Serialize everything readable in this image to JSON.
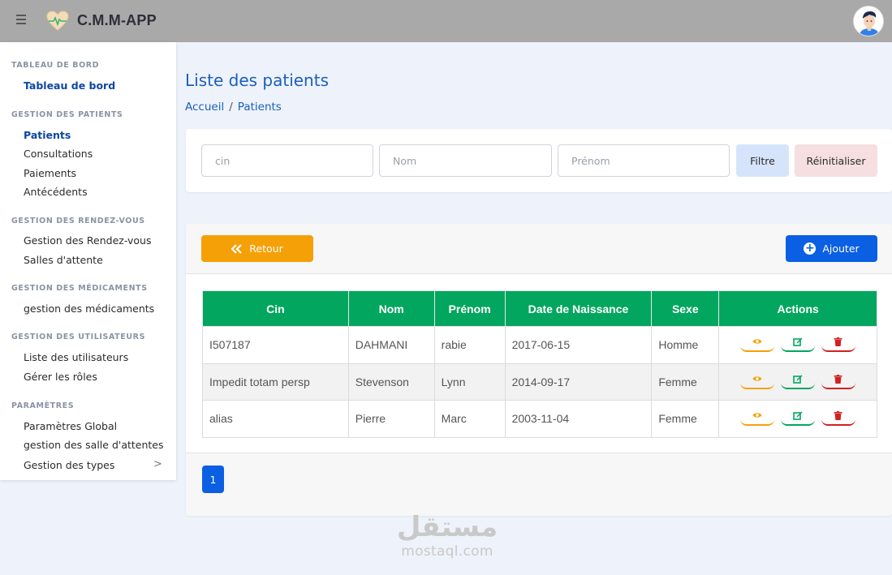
{
  "header": {
    "app_title": "C.M.M-APP",
    "menu_icon": "hamburger-icon",
    "logo_icon": "heart-pulse-icon",
    "avatar_icon": "user-avatar-icon"
  },
  "sidebar": {
    "sections": [
      {
        "heading": "TABLEAU DE BORD",
        "items": [
          "Tableau de bord"
        ]
      },
      {
        "heading": "GESTION DES PATIENTS",
        "items": [
          "Patients",
          "Consultations",
          "Paiements",
          "Antécédents"
        ]
      },
      {
        "heading": "GESTION DES RENDEZ-VOUS",
        "items": [
          "Gestion des Rendez-vous",
          "Salles d'attente"
        ]
      },
      {
        "heading": "GESTION DES MÉDICAMENTS",
        "items": [
          "gestion des médicaments"
        ]
      },
      {
        "heading": "GESTION DES UTILISATEURS",
        "items": [
          "Liste des utilisateurs",
          "Gérer les rôles"
        ]
      },
      {
        "heading": "PARAMÈTRES",
        "items": [
          "Paramètres Global",
          "gestion des salle d'attentes",
          "Gestion des types"
        ]
      }
    ],
    "chevron": ">"
  },
  "main": {
    "title": "Liste des patients",
    "breadcrumb": {
      "home": "Accueil",
      "separator": "/",
      "current": "Patients"
    }
  },
  "filters": {
    "cin_placeholder": "cin",
    "nom_placeholder": "Nom",
    "prenom_placeholder": "Prénom",
    "filter_label": "Filtre",
    "reset_label": "Réinitialiser"
  },
  "toolbar": {
    "back_label": "Retour",
    "back_icon": "double-chevron-left-icon",
    "add_label": "Ajouter",
    "add_icon": "plus-circle-icon"
  },
  "table": {
    "columns": [
      "Cin",
      "Nom",
      "Prénom",
      "Date de Naissance",
      "Sexe",
      "Actions"
    ],
    "rows": [
      [
        "I507187",
        "DAHMANI",
        "rabie",
        "2017-06-15",
        "Homme"
      ],
      [
        "Impedit totam persp",
        "Stevenson",
        "Lynn",
        "2014-09-17",
        "Femme"
      ],
      [
        "alias",
        "Pierre",
        "Marc",
        "2003-11-04",
        "Femme"
      ]
    ],
    "action_icons": [
      "eye-icon",
      "edit-icon",
      "trash-icon"
    ]
  },
  "pagination": {
    "current": "1"
  },
  "watermark": {
    "arabic": "مستقل",
    "latin": "mostaql.com"
  },
  "colors": {
    "header_bg": "#a9a9a9",
    "table_header": "#03a65f",
    "primary": "#0a5fe3",
    "warning": "#f4a006",
    "danger": "#d32020"
  }
}
